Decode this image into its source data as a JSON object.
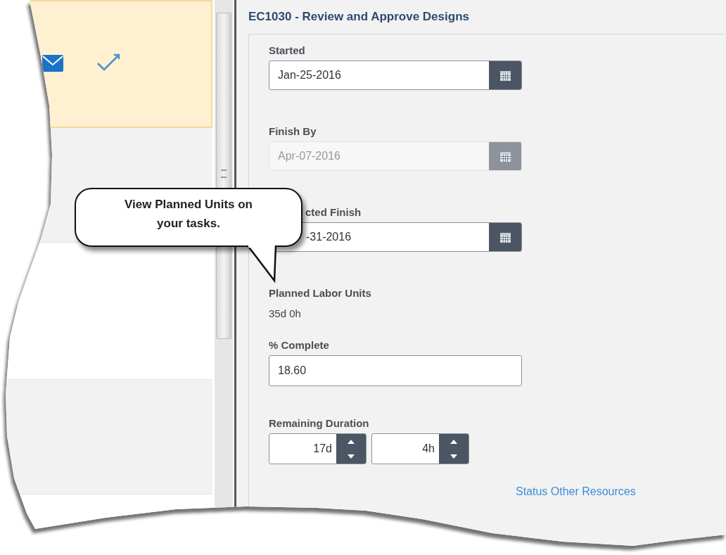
{
  "task_list": {
    "rows": [
      {
        "kind": "highlighted"
      },
      {
        "kind": "shaded"
      },
      {
        "kind": "plain"
      },
      {
        "kind": "shaded"
      },
      {
        "kind": "plain"
      }
    ]
  },
  "form": {
    "title": "EC1030 - Review and Approve Designs",
    "fields": [
      {
        "kind": "date",
        "label": "Started",
        "value": "Jan-25-2016",
        "disabled": false,
        "partly_covered": false
      },
      {
        "kind": "date",
        "label": "Finish By",
        "value": "Apr-07-2016",
        "disabled": true,
        "partly_covered": false
      },
      {
        "kind": "date",
        "label": "cted Finish",
        "value": "-31-2016",
        "disabled": false,
        "partly_covered": true
      },
      {
        "kind": "readout",
        "label": "Planned Labor Units",
        "value": "35d 0h"
      },
      {
        "kind": "text",
        "label": "% Complete",
        "value": "18.60"
      },
      {
        "kind": "duration",
        "label": "Remaining Duration",
        "parts": [
          {
            "value": "17d"
          },
          {
            "value": "4h"
          }
        ]
      }
    ]
  },
  "link": "Status Other Resources",
  "callout": {
    "text": "View Planned Units on your tasks."
  }
}
